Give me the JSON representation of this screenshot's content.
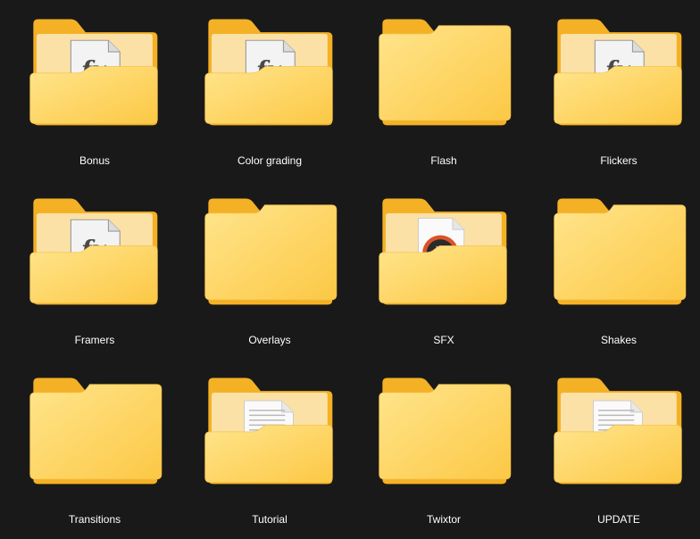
{
  "view": {
    "folders": [
      {
        "name": "Bonus",
        "content": "fx",
        "icon": "folder-fx-icon"
      },
      {
        "name": "Color grading",
        "content": "fx",
        "icon": "folder-fx-icon"
      },
      {
        "name": "Flash",
        "content": "empty",
        "icon": "folder-icon"
      },
      {
        "name": "Flickers",
        "content": "fx",
        "icon": "folder-fx-icon"
      },
      {
        "name": "Framers",
        "content": "fx",
        "icon": "folder-fx-icon"
      },
      {
        "name": "Overlays",
        "content": "empty",
        "icon": "folder-icon"
      },
      {
        "name": "SFX",
        "content": "media",
        "icon": "folder-media-icon"
      },
      {
        "name": "Shakes",
        "content": "empty",
        "icon": "folder-icon"
      },
      {
        "name": "Transitions",
        "content": "empty",
        "icon": "folder-icon"
      },
      {
        "name": "Tutorial",
        "content": "doc",
        "icon": "folder-document-icon"
      },
      {
        "name": "Twixtor",
        "content": "empty",
        "icon": "folder-icon"
      },
      {
        "name": "UPDATE",
        "content": "doc",
        "icon": "folder-document-icon"
      }
    ]
  },
  "colors": {
    "background": "#191919",
    "label": "#ffffff",
    "folder_back": "#f7b928",
    "folder_front_light": "#ffe58a",
    "folder_front_dark": "#fcc845"
  }
}
